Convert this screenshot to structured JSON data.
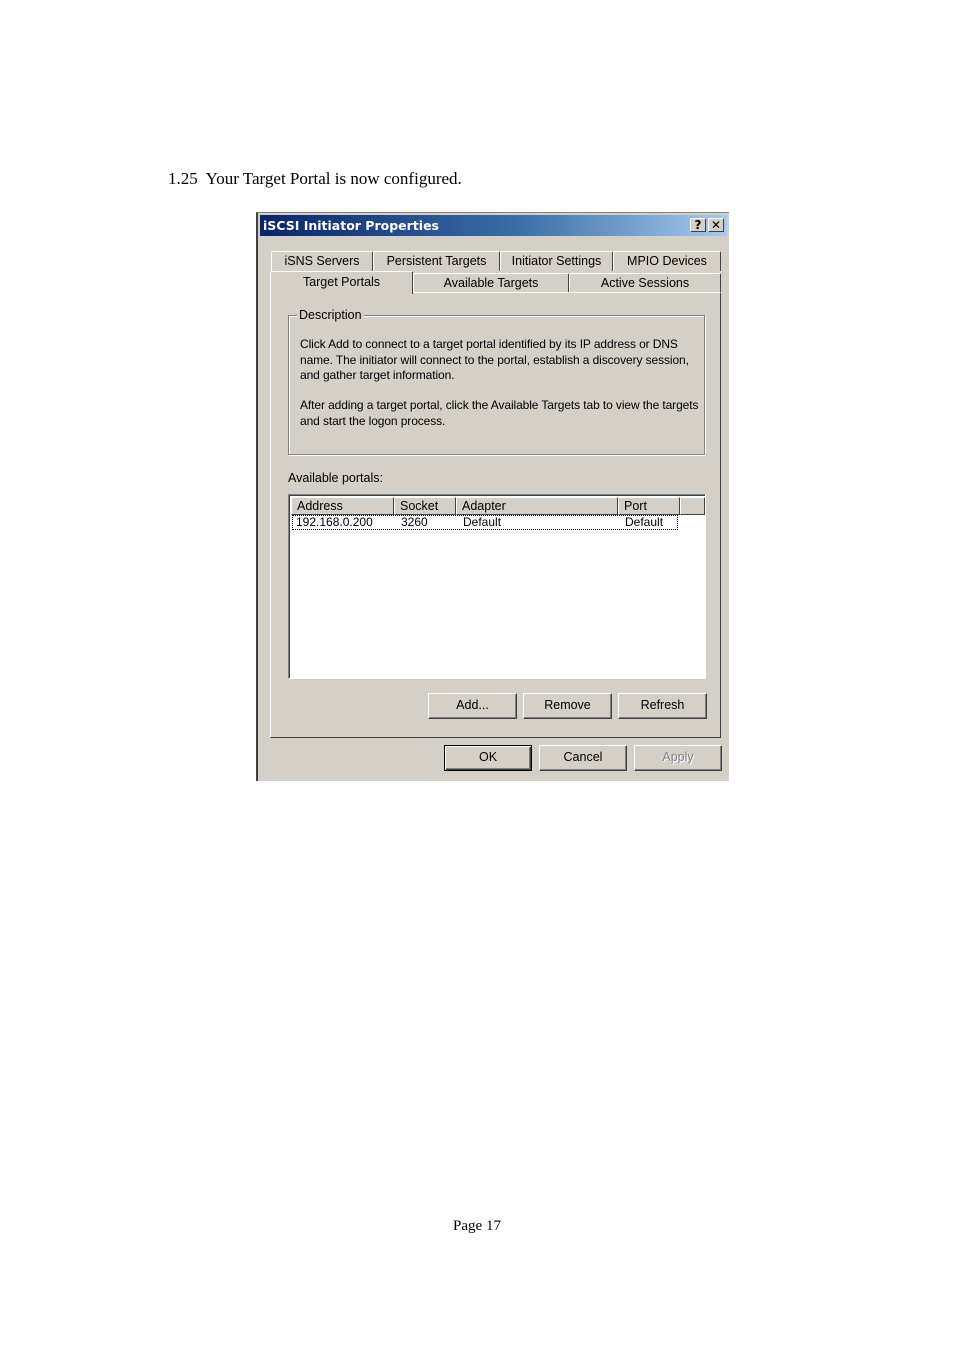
{
  "document": {
    "step_text": "1.25  Your Target Portal is now configured.",
    "page_number": "Page 17"
  },
  "dialog": {
    "title": "iSCSI Initiator Properties",
    "help_glyph": "?",
    "close_glyph": "✕",
    "tabs_back": [
      "iSNS Servers",
      "Persistent Targets",
      "Initiator Settings",
      "MPIO Devices"
    ],
    "tabs_front": [
      "Target Portals",
      "Available Targets",
      "Active Sessions"
    ],
    "active_tab": "Target Portals",
    "description": {
      "legend": "Description",
      "para1": "Click Add to connect to a target portal identified by its IP address or DNS name. The initiator will connect to the portal, establish a discovery session, and gather target information.",
      "para2": "After adding a target portal, click the Available Targets tab to view the targets and start the logon process."
    },
    "portals_label": "Available portals:",
    "columns": [
      "Address",
      "Socket",
      "Adapter",
      "Port"
    ],
    "rows": [
      {
        "address": "192.168.0.200",
        "socket": "3260",
        "adapter": "Default",
        "port": "Default"
      }
    ],
    "buttons": {
      "add": "Add...",
      "remove": "Remove",
      "refresh": "Refresh",
      "ok": "OK",
      "cancel": "Cancel",
      "apply": "Apply"
    }
  }
}
